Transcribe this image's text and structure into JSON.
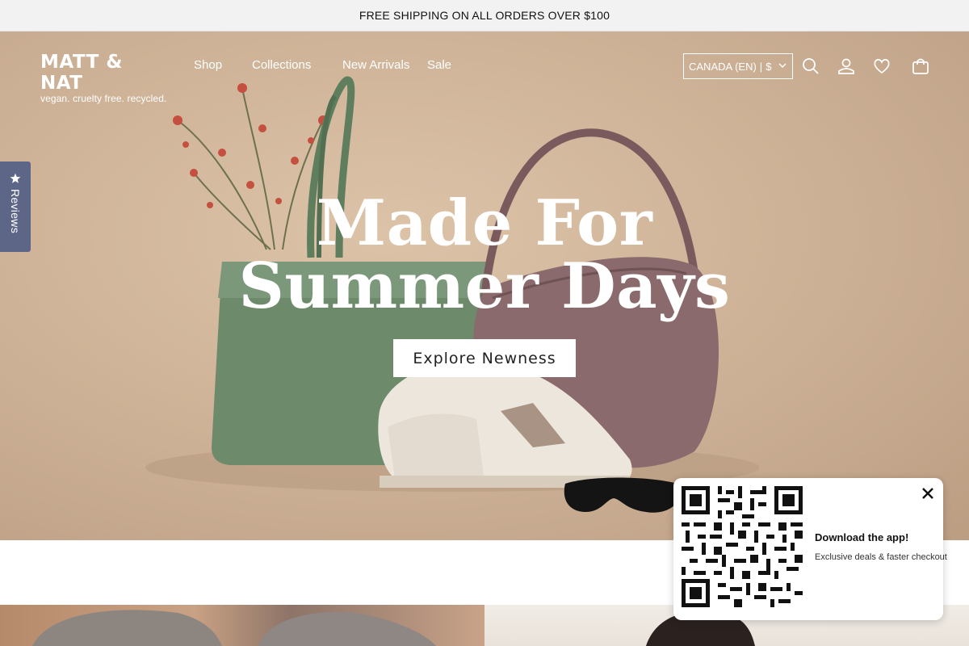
{
  "announcement": {
    "text": "FREE SHIPPING ON ALL ORDERS OVER $100"
  },
  "header": {
    "logo": {
      "name": "MATT & NAT",
      "tagline": "vegan. cruelty free. recycled."
    },
    "nav": [
      "Shop",
      "Collections",
      "New Arrivals",
      "Sale"
    ],
    "country_selector": {
      "value": "CANADA (EN)",
      "currency": "$",
      "separator": "|"
    },
    "icons": [
      "search-icon",
      "account-icon",
      "wishlist-heart-icon",
      "cart-bag-icon"
    ]
  },
  "reviews_tab": {
    "label": "Reviews",
    "icon": "star-icon"
  },
  "hero": {
    "title": "Made For Summer Days",
    "cta_label": "Explore Newness"
  },
  "app_popup": {
    "title": "Download the app!",
    "subtitle": "Exclusive deals & faster checkout",
    "icons": [
      "qr-code-icon",
      "close-icon"
    ]
  },
  "colors": {
    "announcement_bg": "#f2f2f2",
    "reviews_tab_bg": "#5e6688",
    "hero_bg": "#ccb095",
    "tote_green": "#6d8b6b",
    "hobo_mauve": "#8a6a6c"
  }
}
